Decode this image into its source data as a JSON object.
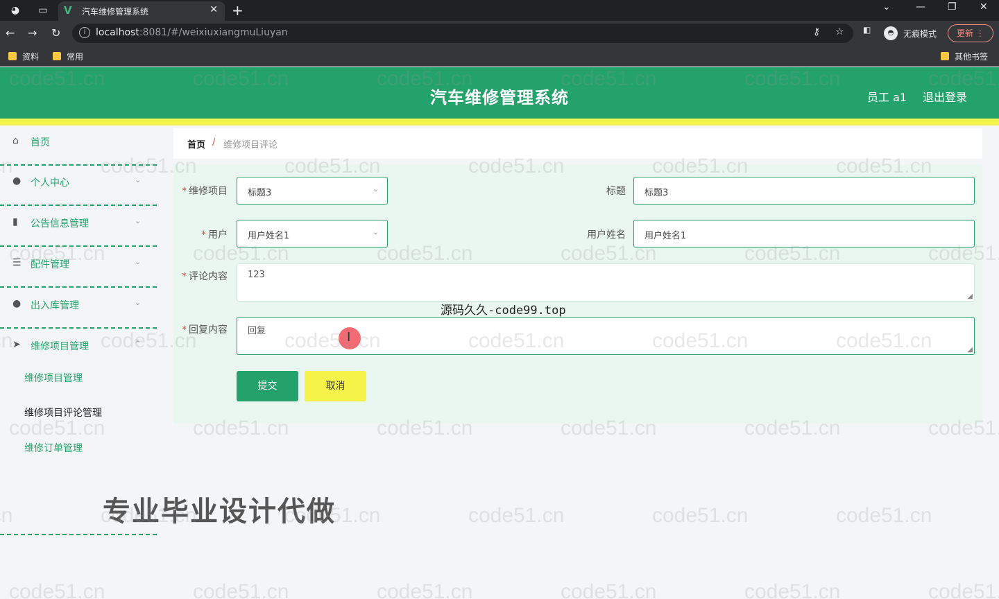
{
  "browser": {
    "tab_title": "汽车维修管理系统",
    "url_host": "localhost",
    "url_rest": ":8081/#/weixiuxiangmuLiuyan",
    "incognito_label": "无痕模式",
    "update_label": "更新",
    "bookmarks": [
      "资料",
      "常用"
    ],
    "other_bookmarks": "其他书签"
  },
  "header": {
    "title": "汽车维修管理系统",
    "user": "员工 a1",
    "logout": "退出登录"
  },
  "sidebar": {
    "items": [
      {
        "label": "首页",
        "icon": "home-icon"
      },
      {
        "label": "个人中心",
        "icon": "user-icon"
      },
      {
        "label": "公告信息管理",
        "icon": "bar-chart-icon"
      },
      {
        "label": "配件管理",
        "icon": "sliders-icon"
      },
      {
        "label": "出入库管理",
        "icon": "bulb-icon"
      },
      {
        "label": "维修项目管理",
        "icon": "send-icon"
      }
    ],
    "sub_items": [
      "维修项目管理",
      "维修项目评论管理",
      "维修订单管理"
    ]
  },
  "breadcrumb": {
    "home": "首页",
    "separator": "/",
    "current": "维修项目评论"
  },
  "form": {
    "project_label": "维修项目",
    "project_value": "标题3",
    "title_label": "标题",
    "title_value": "标题3",
    "user_label": "用户",
    "user_value": "用户姓名1",
    "username_label": "用户姓名",
    "username_value": "用户姓名1",
    "comment_label": "评论内容",
    "comment_value": "123",
    "reply_label": "回复内容",
    "reply_value": "回复",
    "submit_label": "提交",
    "cancel_label": "取消"
  },
  "overlays": {
    "code_text": "源码久久-code99.top",
    "ad_text": "专业毕业设计代做",
    "watermark": "code51.cn"
  },
  "colors": {
    "primary": "#24a26b",
    "accent_yellow": "#f5f24a",
    "required": "#e24a4a"
  }
}
